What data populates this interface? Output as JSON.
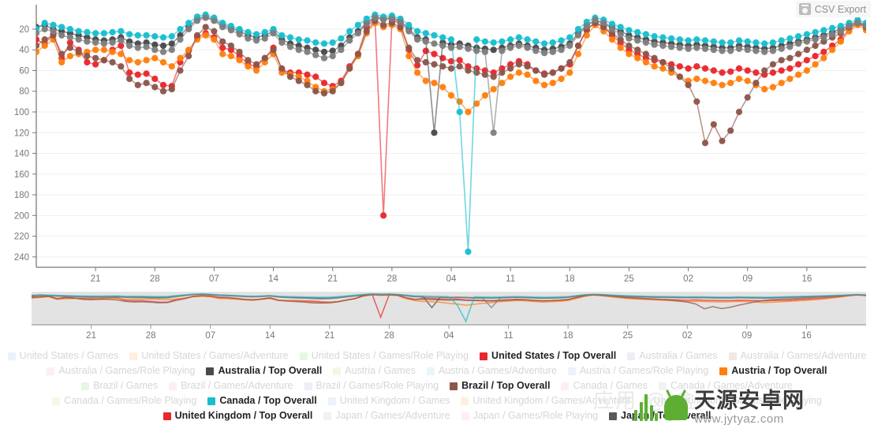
{
  "toolbar": {
    "csv_export_label": "CSV Export",
    "csv_export_icon": "camera-save-icon"
  },
  "watermark": {
    "brand_cn": "天源安卓网",
    "url": "www.jytyaz.com",
    "ghost_text": "应用 @ 盒"
  },
  "chart_data": {
    "type": "line",
    "title": "",
    "xlabel": "",
    "ylabel": "",
    "y_axis_inverted": true,
    "ylim": [
      1,
      250
    ],
    "yticks": [
      20,
      40,
      60,
      80,
      100,
      120,
      140,
      160,
      180,
      200,
      220,
      240
    ],
    "xticks": [
      "21",
      "28",
      "07",
      "14",
      "21",
      "28",
      "04",
      "11",
      "18",
      "25",
      "02",
      "09",
      "16"
    ],
    "xtick_positions": [
      7,
      14,
      21,
      28,
      35,
      42,
      49,
      56,
      63,
      70,
      77,
      84,
      91
    ],
    "n_points": 99,
    "grid": true,
    "legend_position": "bottom",
    "markers": "circle",
    "series": [
      {
        "name": "United States / Top Overall",
        "color": "#e8282e",
        "visible": true,
        "values": [
          30,
          34,
          25,
          48,
          33,
          40,
          52,
          54,
          50,
          40,
          36,
          62,
          64,
          63,
          68,
          74,
          75,
          52,
          41,
          28,
          24,
          28,
          38,
          40,
          46,
          54,
          56,
          48,
          38,
          59,
          62,
          62,
          64,
          66,
          72,
          75,
          70,
          56,
          44,
          18,
          10,
          200,
          12,
          14,
          40,
          55,
          41,
          44,
          48,
          51,
          50,
          56,
          58,
          60,
          62,
          58,
          54,
          51,
          54,
          60,
          63,
          62,
          58,
          54,
          36,
          21,
          13,
          18,
          26,
          33,
          40,
          44,
          48,
          50,
          52,
          54,
          56,
          58,
          56,
          58,
          60,
          62,
          61,
          58,
          60,
          62,
          64,
          62,
          60,
          58,
          54,
          50,
          46,
          42,
          36,
          30,
          20,
          14,
          19
        ]
      },
      {
        "name": "Australia / Top Overall",
        "color": "#4a4a4a",
        "visible": true,
        "values": [
          18,
          16,
          20,
          22,
          24,
          26,
          28,
          30,
          31,
          30,
          28,
          32,
          34,
          33,
          35,
          36,
          34,
          26,
          18,
          10,
          8,
          11,
          16,
          19,
          22,
          26,
          28,
          26,
          22,
          30,
          34,
          36,
          38,
          40,
          42,
          41,
          36,
          28,
          22,
          14,
          8,
          10,
          9,
          12,
          20,
          28,
          30,
          120,
          33,
          35,
          34,
          36,
          38,
          39,
          40,
          38,
          36,
          34,
          36,
          38,
          40,
          39,
          37,
          34,
          24,
          16,
          12,
          14,
          18,
          22,
          26,
          28,
          30,
          32,
          33,
          34,
          35,
          36,
          35,
          36,
          37,
          38,
          38,
          36,
          37,
          38,
          39,
          38,
          36,
          34,
          32,
          30,
          28,
          26,
          23,
          20,
          16,
          13,
          16
        ]
      },
      {
        "name": "Austria / Top Overall",
        "color": "#ff7f0e",
        "visible": true,
        "values": [
          42,
          36,
          30,
          52,
          46,
          44,
          42,
          40,
          40,
          42,
          44,
          50,
          52,
          50,
          48,
          52,
          56,
          48,
          40,
          30,
          26,
          30,
          44,
          46,
          50,
          56,
          60,
          52,
          44,
          62,
          64,
          66,
          70,
          76,
          80,
          78,
          72,
          58,
          46,
          24,
          14,
          18,
          16,
          20,
          46,
          62,
          70,
          72,
          76,
          84,
          90,
          100,
          92,
          84,
          78,
          72,
          66,
          62,
          64,
          70,
          74,
          72,
          68,
          62,
          44,
          26,
          16,
          22,
          30,
          38,
          44,
          48,
          52,
          56,
          58,
          62,
          66,
          70,
          68,
          70,
          72,
          74,
          72,
          68,
          70,
          74,
          78,
          76,
          72,
          68,
          64,
          60,
          54,
          48,
          40,
          32,
          22,
          16,
          21
        ]
      },
      {
        "name": "Brazil / Top Overall",
        "color": "#8c564b",
        "visible": true,
        "values": [
          36,
          30,
          26,
          44,
          38,
          42,
          46,
          48,
          50,
          52,
          56,
          68,
          74,
          72,
          76,
          80,
          78,
          60,
          46,
          26,
          18,
          22,
          32,
          36,
          42,
          50,
          54,
          48,
          40,
          58,
          66,
          70,
          74,
          80,
          82,
          80,
          72,
          58,
          44,
          22,
          12,
          16,
          14,
          18,
          38,
          50,
          52,
          54,
          56,
          58,
          56,
          60,
          62,
          64,
          66,
          62,
          58,
          54,
          56,
          60,
          64,
          62,
          58,
          52,
          36,
          20,
          14,
          18,
          24,
          30,
          36,
          40,
          44,
          48,
          52,
          58,
          66,
          74,
          90,
          130,
          112,
          128,
          118,
          100,
          86,
          72,
          60,
          54,
          50,
          48,
          44,
          40,
          36,
          32,
          28,
          24,
          18,
          14,
          18
        ]
      },
      {
        "name": "Canada / Top Overall",
        "color": "#17becf",
        "visible": true,
        "values": [
          20,
          14,
          16,
          18,
          20,
          22,
          23,
          24,
          24,
          23,
          22,
          25,
          26,
          26,
          27,
          28,
          27,
          20,
          14,
          8,
          6,
          9,
          14,
          17,
          20,
          23,
          25,
          23,
          20,
          26,
          28,
          30,
          31,
          33,
          34,
          33,
          29,
          22,
          16,
          10,
          6,
          8,
          7,
          10,
          16,
          22,
          24,
          26,
          28,
          30,
          100,
          235,
          30,
          32,
          33,
          32,
          30,
          28,
          30,
          32,
          34,
          33,
          31,
          28,
          20,
          13,
          9,
          11,
          15,
          18,
          21,
          23,
          25,
          27,
          28,
          29,
          30,
          31,
          30,
          31,
          32,
          33,
          33,
          31,
          32,
          33,
          34,
          33,
          31,
          29,
          27,
          25,
          23,
          21,
          19,
          17,
          14,
          11,
          14
        ]
      },
      {
        "name": "Japan / Top Overall",
        "color": "#7f7f7f",
        "visible": true,
        "values": [
          24,
          20,
          22,
          26,
          28,
          30,
          32,
          33,
          34,
          33,
          31,
          36,
          38,
          37,
          40,
          42,
          40,
          30,
          20,
          12,
          9,
          12,
          18,
          21,
          25,
          29,
          31,
          29,
          24,
          33,
          37,
          40,
          42,
          45,
          48,
          46,
          40,
          31,
          24,
          15,
          9,
          11,
          10,
          13,
          22,
          30,
          32,
          34,
          36,
          38,
          37,
          39,
          41,
          42,
          120,
          41,
          38,
          36,
          38,
          41,
          43,
          42,
          40,
          36,
          26,
          17,
          11,
          14,
          20,
          25,
          29,
          31,
          33,
          35,
          36,
          37,
          38,
          39,
          38,
          39,
          40,
          41,
          41,
          39,
          40,
          41,
          42,
          41,
          39,
          37,
          34,
          32,
          30,
          28,
          25,
          22,
          17,
          14,
          17
        ]
      }
    ]
  },
  "legend": {
    "items": [
      {
        "label": "United States / Games",
        "color": "#aec7e8",
        "active": false
      },
      {
        "label": "United States / Games/Adventure",
        "color": "#ffbb78",
        "active": false
      },
      {
        "label": "United States / Games/Role Playing",
        "color": "#98df8a",
        "active": false
      },
      {
        "label": "United States / Top Overall",
        "color": "#e8282e",
        "active": true
      },
      {
        "label": "Australia / Games",
        "color": "#c5b0d5",
        "active": false
      },
      {
        "label": "Australia / Games/Adventure",
        "color": "#c49c94",
        "active": false
      },
      {
        "label": "Australia / Games/Role Playing",
        "color": "#f7b6d2",
        "active": false
      },
      {
        "label": "Australia / Top Overall",
        "color": "#4a4a4a",
        "active": true
      },
      {
        "label": "Austria / Games",
        "color": "#dbdb8d",
        "active": false
      },
      {
        "label": "Austria / Games/Adventure",
        "color": "#9edae5",
        "active": false
      },
      {
        "label": "Austria / Games/Role Playing",
        "color": "#aec7e8",
        "active": false
      },
      {
        "label": "Austria / Top Overall",
        "color": "#ff7f0e",
        "active": true
      },
      {
        "label": "Brazil / Games",
        "color": "#98df8a",
        "active": false
      },
      {
        "label": "Brazil / Games/Adventure",
        "color": "#f7b6d2",
        "active": false
      },
      {
        "label": "Brazil / Games/Role Playing",
        "color": "#c5b0d5",
        "active": false
      },
      {
        "label": "Brazil / Top Overall",
        "color": "#8c564b",
        "active": true
      },
      {
        "label": "Canada / Games",
        "color": "#f7b6d2",
        "active": false
      },
      {
        "label": "Canada / Games/Adventure",
        "color": "#c7c7c7",
        "active": false
      },
      {
        "label": "Canada / Games/Role Playing",
        "color": "#dbdb8d",
        "active": false
      },
      {
        "label": "Canada / Top Overall",
        "color": "#17becf",
        "active": true
      },
      {
        "label": "United Kingdom / Games",
        "color": "#aec7e8",
        "active": false
      },
      {
        "label": "United Kingdom / Games/Adventure",
        "color": "#ffbb78",
        "active": false
      },
      {
        "label": "United Kingdom / Games/Role Playing",
        "color": "#98df8a",
        "active": false
      },
      {
        "label": "United Kingdom / Top Overall",
        "color": "#e8282e",
        "active": true
      },
      {
        "label": "Japan / Games/Adventure",
        "color": "#c7c7c7",
        "active": false
      },
      {
        "label": "Japan / Games/Role Playing",
        "color": "#f7b6d2",
        "active": false
      },
      {
        "label": "Japan / Top Overall",
        "color": "#595959",
        "active": true
      }
    ]
  }
}
